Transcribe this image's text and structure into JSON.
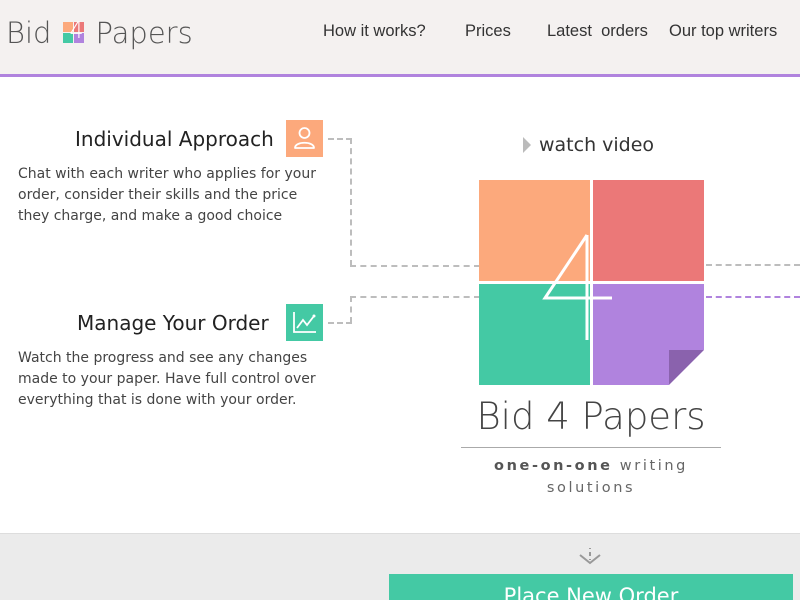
{
  "brand": {
    "name_left": "Bid",
    "name_mark": "4",
    "name_right": "Papers",
    "full_name": "Bid 4 Papers",
    "tagline_bold": "one-on-one",
    "tagline_rest": " writing solutions"
  },
  "nav": {
    "how": "How it works?",
    "prices": "Prices",
    "latest": "Latest  orders",
    "top": "Our top writers"
  },
  "features": [
    {
      "title": "Individual Approach",
      "text": "Chat with each writer who applies for your order, consider their skills and the price they charge, and make a good choice",
      "icon": "user-icon"
    },
    {
      "title": "Manage Your Order",
      "text": "Watch the progress and see any changes made to your paper. Have full control over everything that is done with your order.",
      "icon": "chart-icon"
    }
  ],
  "video": {
    "label": "watch video"
  },
  "cta": {
    "label": "Place New Order"
  },
  "colors": {
    "orange": "#fca97c",
    "red": "#eb7878",
    "green": "#44c9a4",
    "purple": "#b083de"
  }
}
